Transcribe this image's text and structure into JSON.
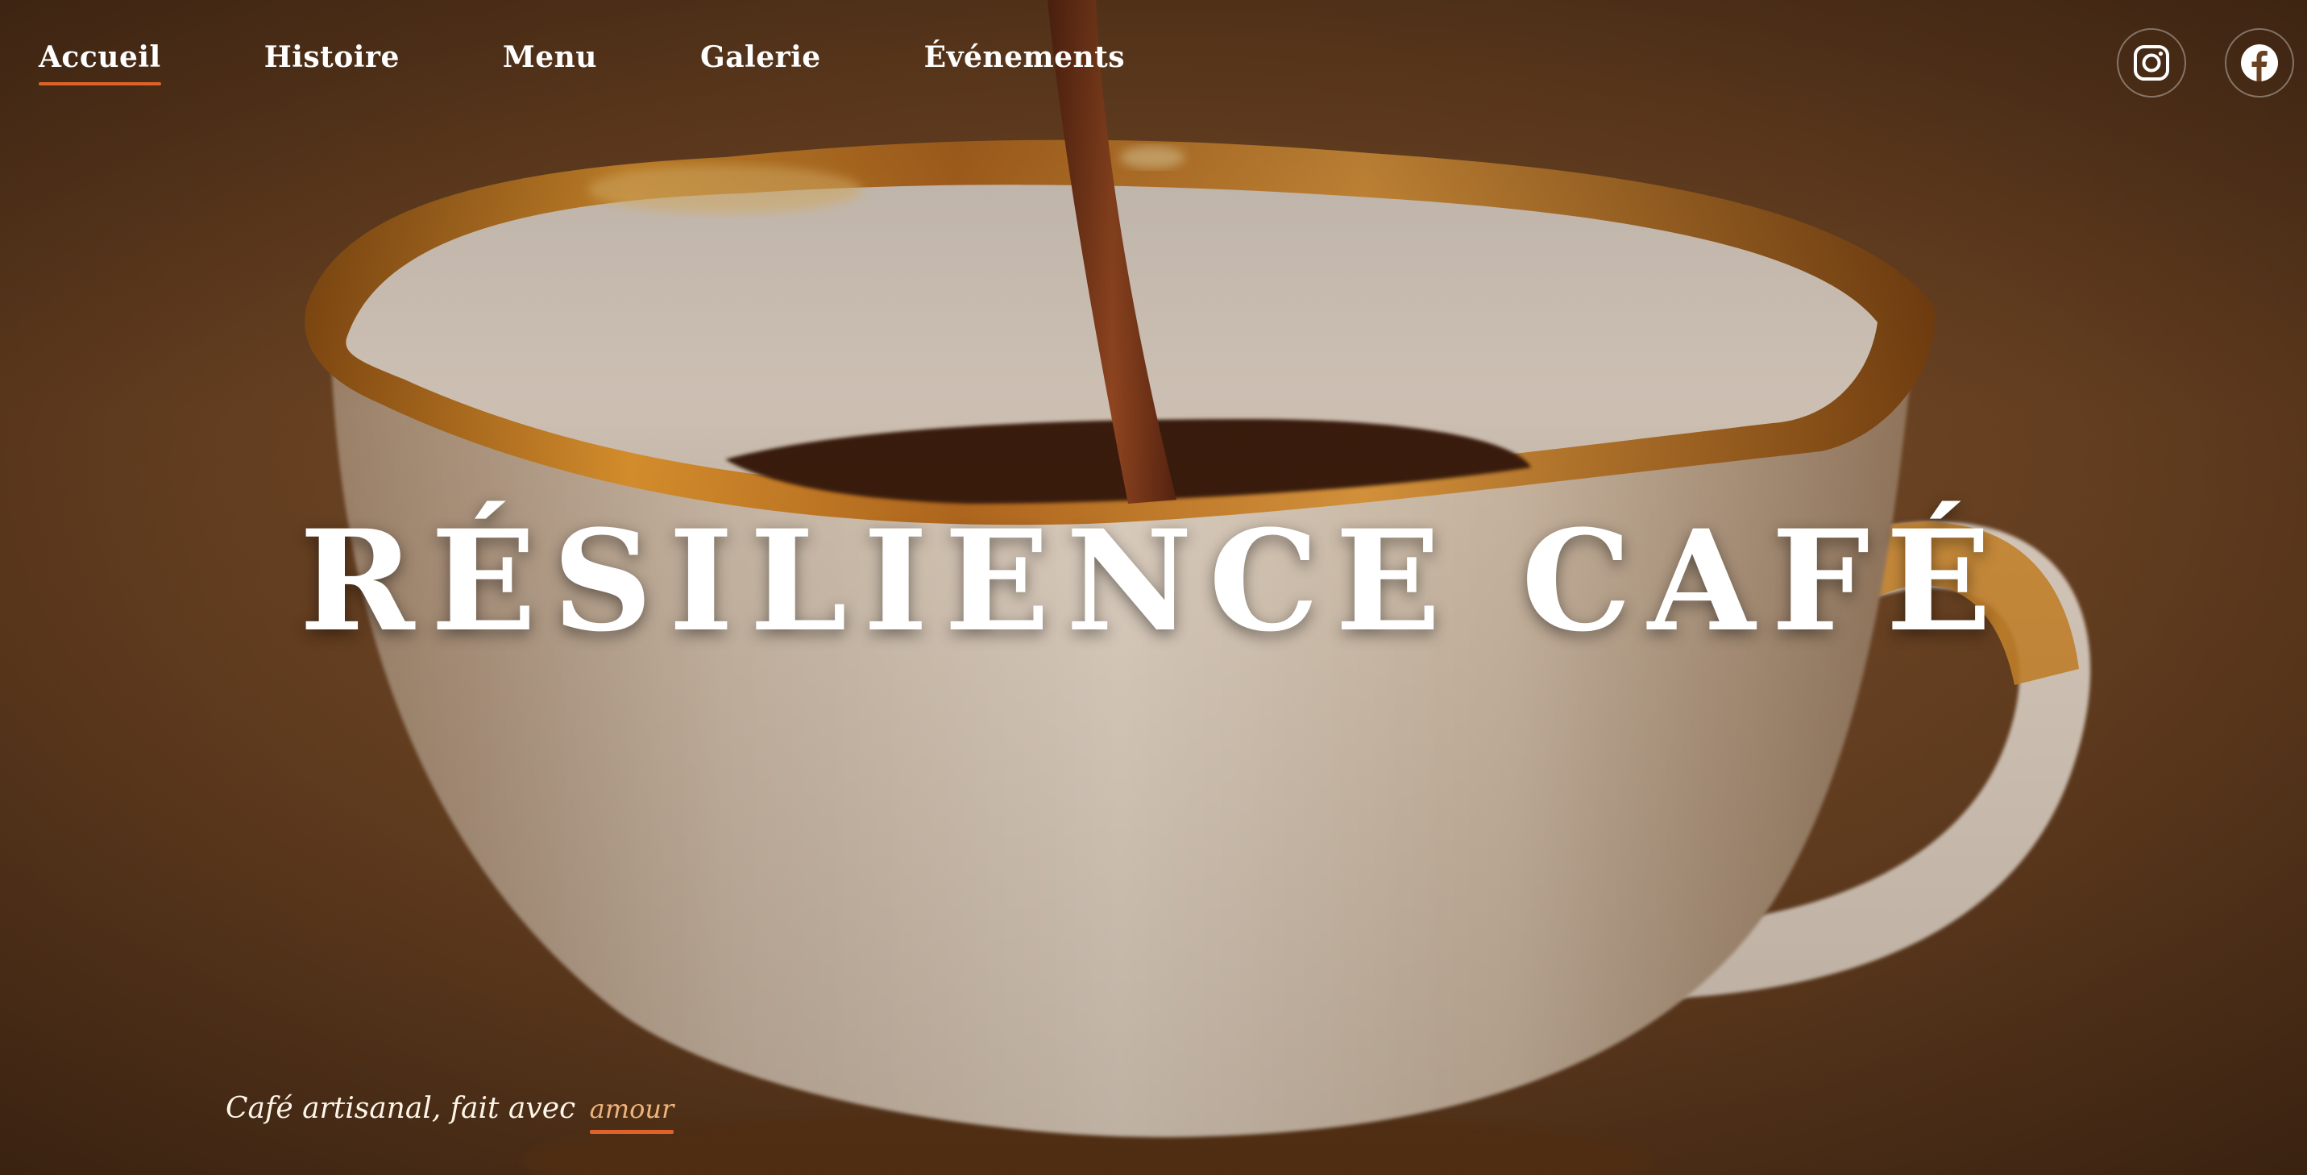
{
  "nav": {
    "items": [
      {
        "label": "Accueil",
        "active": true
      },
      {
        "label": "Histoire",
        "active": false
      },
      {
        "label": "Menu",
        "active": false
      },
      {
        "label": "Galerie",
        "active": false
      },
      {
        "label": "Événements",
        "active": false
      }
    ]
  },
  "social": {
    "instagram_icon": "instagram-icon",
    "facebook_icon": "facebook-icon"
  },
  "hero": {
    "title": "RÉSILIENCE CAFÉ",
    "tagline_text": "Café artisanal, fait avec",
    "tagline_accent": "amour"
  },
  "colors": {
    "accent": "#e0622b",
    "accent_text": "#f0b47a",
    "text": "#ffffff"
  }
}
